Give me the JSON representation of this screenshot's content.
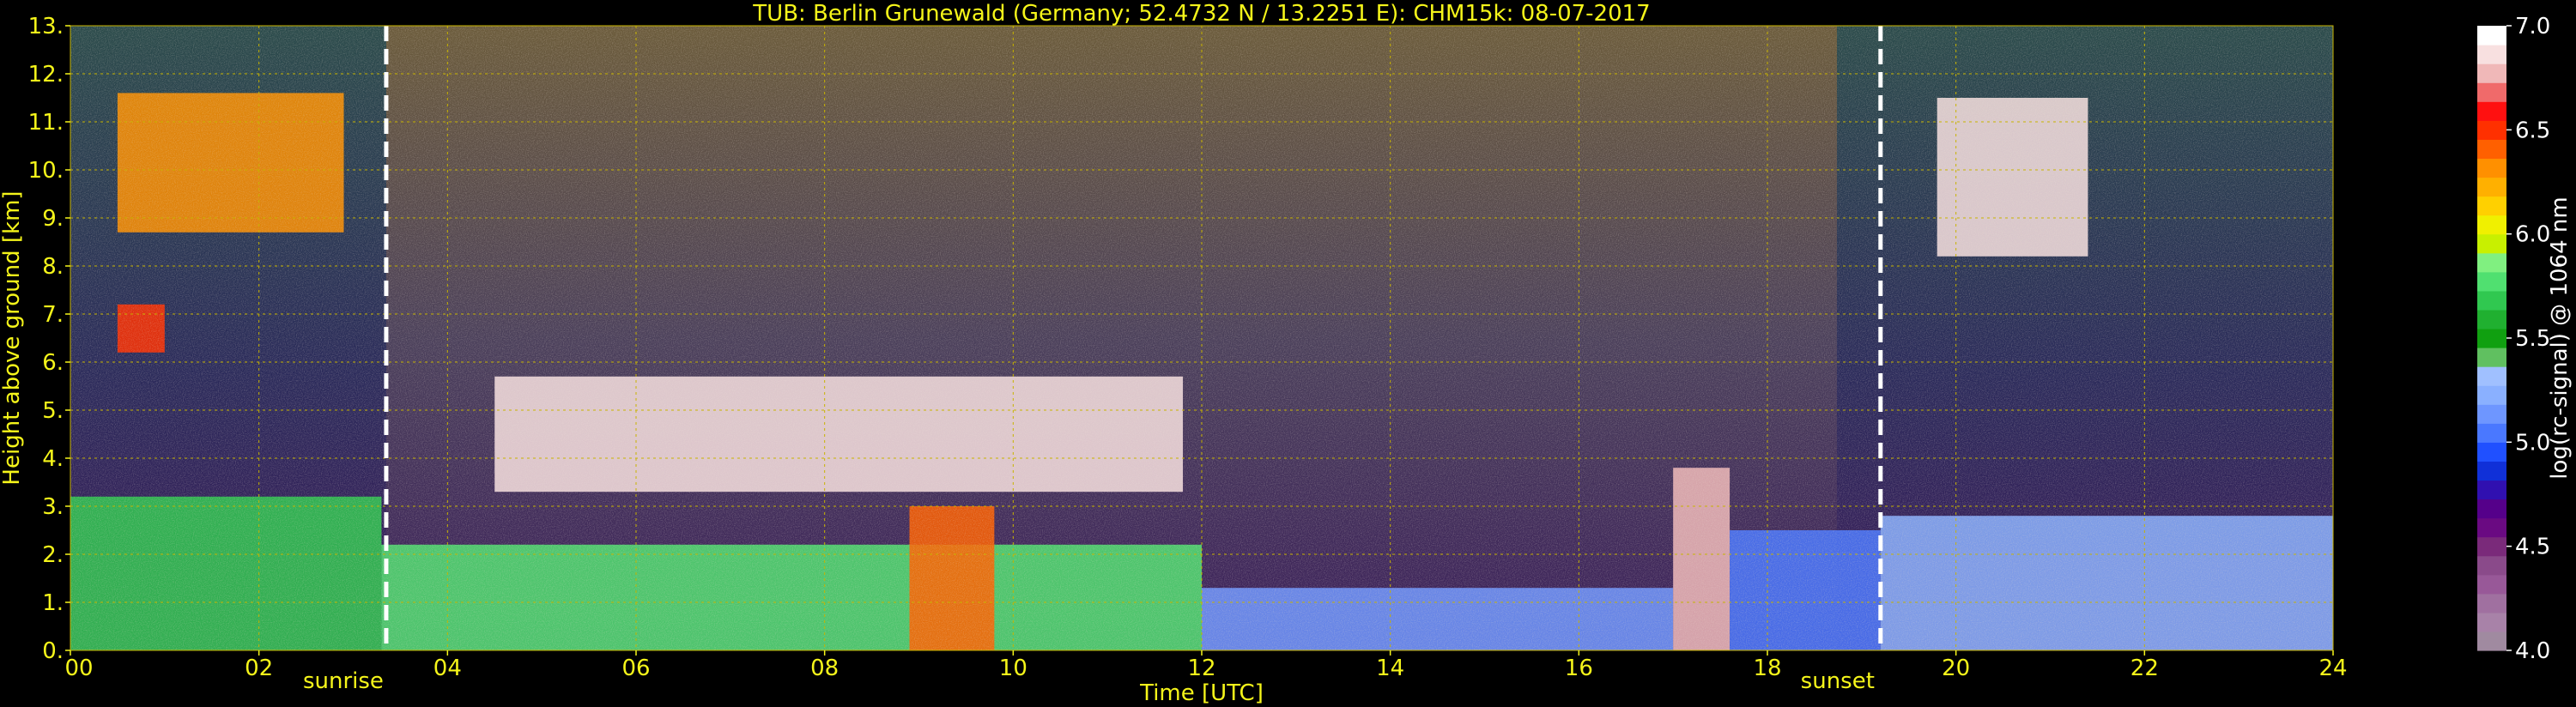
{
  "colors": {
    "background": "#000000",
    "text": "#f5f51a",
    "grid": "#c8b400",
    "event_line": "#ffffff"
  },
  "chart_data": {
    "type": "heatmap",
    "title": "TUB: Berlin Grunewald (Germany; 52.4732 N / 13.2251 E):    CHM15k: 08-07-2017",
    "xlabel": "Time [UTC]",
    "ylabel": "Height above ground [km]",
    "xlim": [
      0,
      24
    ],
    "ylim": [
      0,
      13
    ],
    "x_ticks": [
      0,
      2,
      4,
      6,
      8,
      10,
      12,
      14,
      16,
      18,
      20,
      22,
      24
    ],
    "x_tick_labels": [
      "00",
      "02",
      "04",
      "06",
      "08",
      "10",
      "12",
      "14",
      "16",
      "18",
      "20",
      "22",
      "24"
    ],
    "y_ticks": [
      0,
      1,
      2,
      3,
      4,
      5,
      6,
      7,
      8,
      9,
      10,
      11,
      12,
      13
    ],
    "y_tick_labels": [
      "0.",
      "1.",
      "2.",
      "3.",
      "4.",
      "5.",
      "6.",
      "7.",
      "8.",
      "9.",
      "10.",
      "11.",
      "12.",
      "13."
    ],
    "grid": true,
    "events": [
      {
        "label": "sunrise",
        "time": 3.35
      },
      {
        "label": "sunset",
        "time": 19.2
      }
    ],
    "colorbar": {
      "label": "log(rc-signal) @ 1064 nm",
      "range": [
        4.0,
        7.0
      ],
      "ticks": [
        4.0,
        4.5,
        5.0,
        5.5,
        6.0,
        6.5,
        7.0
      ],
      "tick_labels": [
        "4.0",
        "4.5",
        "5.0",
        "5.5",
        "6.0",
        "6.5",
        "7.0"
      ],
      "colors": [
        "#a08aa0",
        "#a882a8",
        "#a070a0",
        "#985898",
        "#8a4a8a",
        "#7a2a7a",
        "#6a0a82",
        "#55008a",
        "#3010b0",
        "#1030d8",
        "#2050ff",
        "#4a78ff",
        "#6e96ff",
        "#8ab0ff",
        "#a0c0ff",
        "#60c060",
        "#10a010",
        "#20b030",
        "#30c850",
        "#50e070",
        "#80f080",
        "#c8f000",
        "#f0f000",
        "#ffd000",
        "#ffb000",
        "#ff9000",
        "#ff6000",
        "#ff3000",
        "#ff1010",
        "#f06a6a",
        "#f0b8b8",
        "#f8e0e0",
        "#ffffff"
      ]
    },
    "layers": [
      {
        "t0": 0.0,
        "t1": 3.3,
        "z0": 0.0,
        "z1": 3.2,
        "value": 5.7
      },
      {
        "t0": 3.3,
        "t1": 12.0,
        "z0": 0.0,
        "z1": 2.2,
        "value": 5.8
      },
      {
        "t0": 8.9,
        "t1": 9.8,
        "z0": 0.0,
        "z1": 3.0,
        "value": 6.4
      },
      {
        "t0": 12.0,
        "t1": 17.0,
        "z0": 0.0,
        "z1": 1.3,
        "value": 5.1
      },
      {
        "t0": 17.0,
        "t1": 17.6,
        "z0": 0.0,
        "z1": 3.8,
        "value": 6.8
      },
      {
        "t0": 17.6,
        "t1": 19.2,
        "z0": 0.0,
        "z1": 2.5,
        "value": 5.0
      },
      {
        "t0": 19.2,
        "t1": 24.0,
        "z0": 0.0,
        "z1": 2.8,
        "value": 5.2
      },
      {
        "t0": 4.5,
        "t1": 11.8,
        "z0": 3.3,
        "z1": 5.7,
        "value": 6.9
      },
      {
        "t0": 0.5,
        "t1": 2.9,
        "z0": 8.7,
        "z1": 11.6,
        "value": 6.3
      },
      {
        "t0": 19.8,
        "t1": 21.4,
        "z0": 8.2,
        "z1": 11.5,
        "value": 6.9
      },
      {
        "t0": 0.5,
        "t1": 1.0,
        "z0": 6.2,
        "z1": 7.2,
        "value": 6.5
      }
    ]
  }
}
